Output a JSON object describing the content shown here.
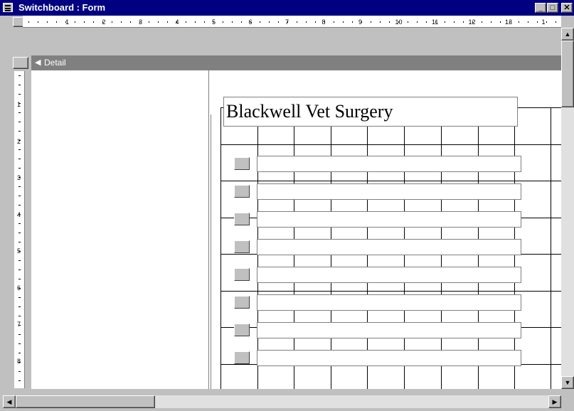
{
  "window": {
    "title": "Switchboard : Form",
    "min_glyph": "_",
    "max_glyph": "□",
    "close_glyph": "✕"
  },
  "section": {
    "label": "Detail"
  },
  "form": {
    "title_label": "Blackwell Vet Surgery"
  },
  "ruler": {
    "horizontal": [
      "1",
      "2",
      "3",
      "4",
      "5",
      "6",
      "7",
      "8",
      "9",
      "10",
      "11",
      "12",
      "13",
      "1"
    ],
    "vertical": [
      "1",
      "2",
      "3",
      "4",
      "5",
      "6",
      "7",
      "8"
    ]
  },
  "options": [
    {
      "id": 1,
      "label": ""
    },
    {
      "id": 2,
      "label": ""
    },
    {
      "id": 3,
      "label": ""
    },
    {
      "id": 4,
      "label": ""
    },
    {
      "id": 5,
      "label": ""
    },
    {
      "id": 6,
      "label": ""
    },
    {
      "id": 7,
      "label": ""
    },
    {
      "id": 8,
      "label": ""
    }
  ],
  "scroll": {
    "up_glyph": "▲",
    "down_glyph": "▼",
    "left_glyph": "◀",
    "right_glyph": "▶"
  },
  "colors": {
    "titlebar": "#000080",
    "section_bar": "#808080",
    "face": "#c0c0c0"
  },
  "icons": {
    "window": "form-icon",
    "section": "section-arrow-icon"
  }
}
